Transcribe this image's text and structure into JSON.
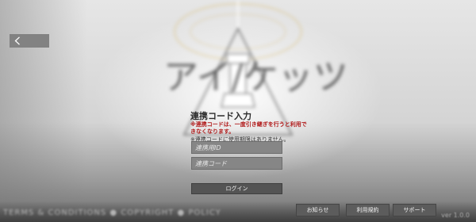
{
  "background": {
    "logo_text": "アイ/ケッツ",
    "bottom_text": "TERMS & CONDITIONS ● COPYRIGHT ● POLICY",
    "corner_text": "ver 1.0.0"
  },
  "nav": {
    "back_icon": "chevron-left-icon"
  },
  "login": {
    "title": "連携コード入力",
    "notice_red": "※連携コードは、一度引き継ぎを行うと利用できなくなります。",
    "notice_dark": "※連携コードに使用期限はありません。",
    "id_placeholder": "連携用ID",
    "code_placeholder": "連携コード",
    "login_label": "ログイン"
  },
  "footer": {
    "news_label": "お知らせ",
    "terms_label": "利用規約",
    "support_label": "サポート"
  },
  "colors": {
    "accent_gold": "#d9b55a",
    "notice_red": "#b01818"
  }
}
